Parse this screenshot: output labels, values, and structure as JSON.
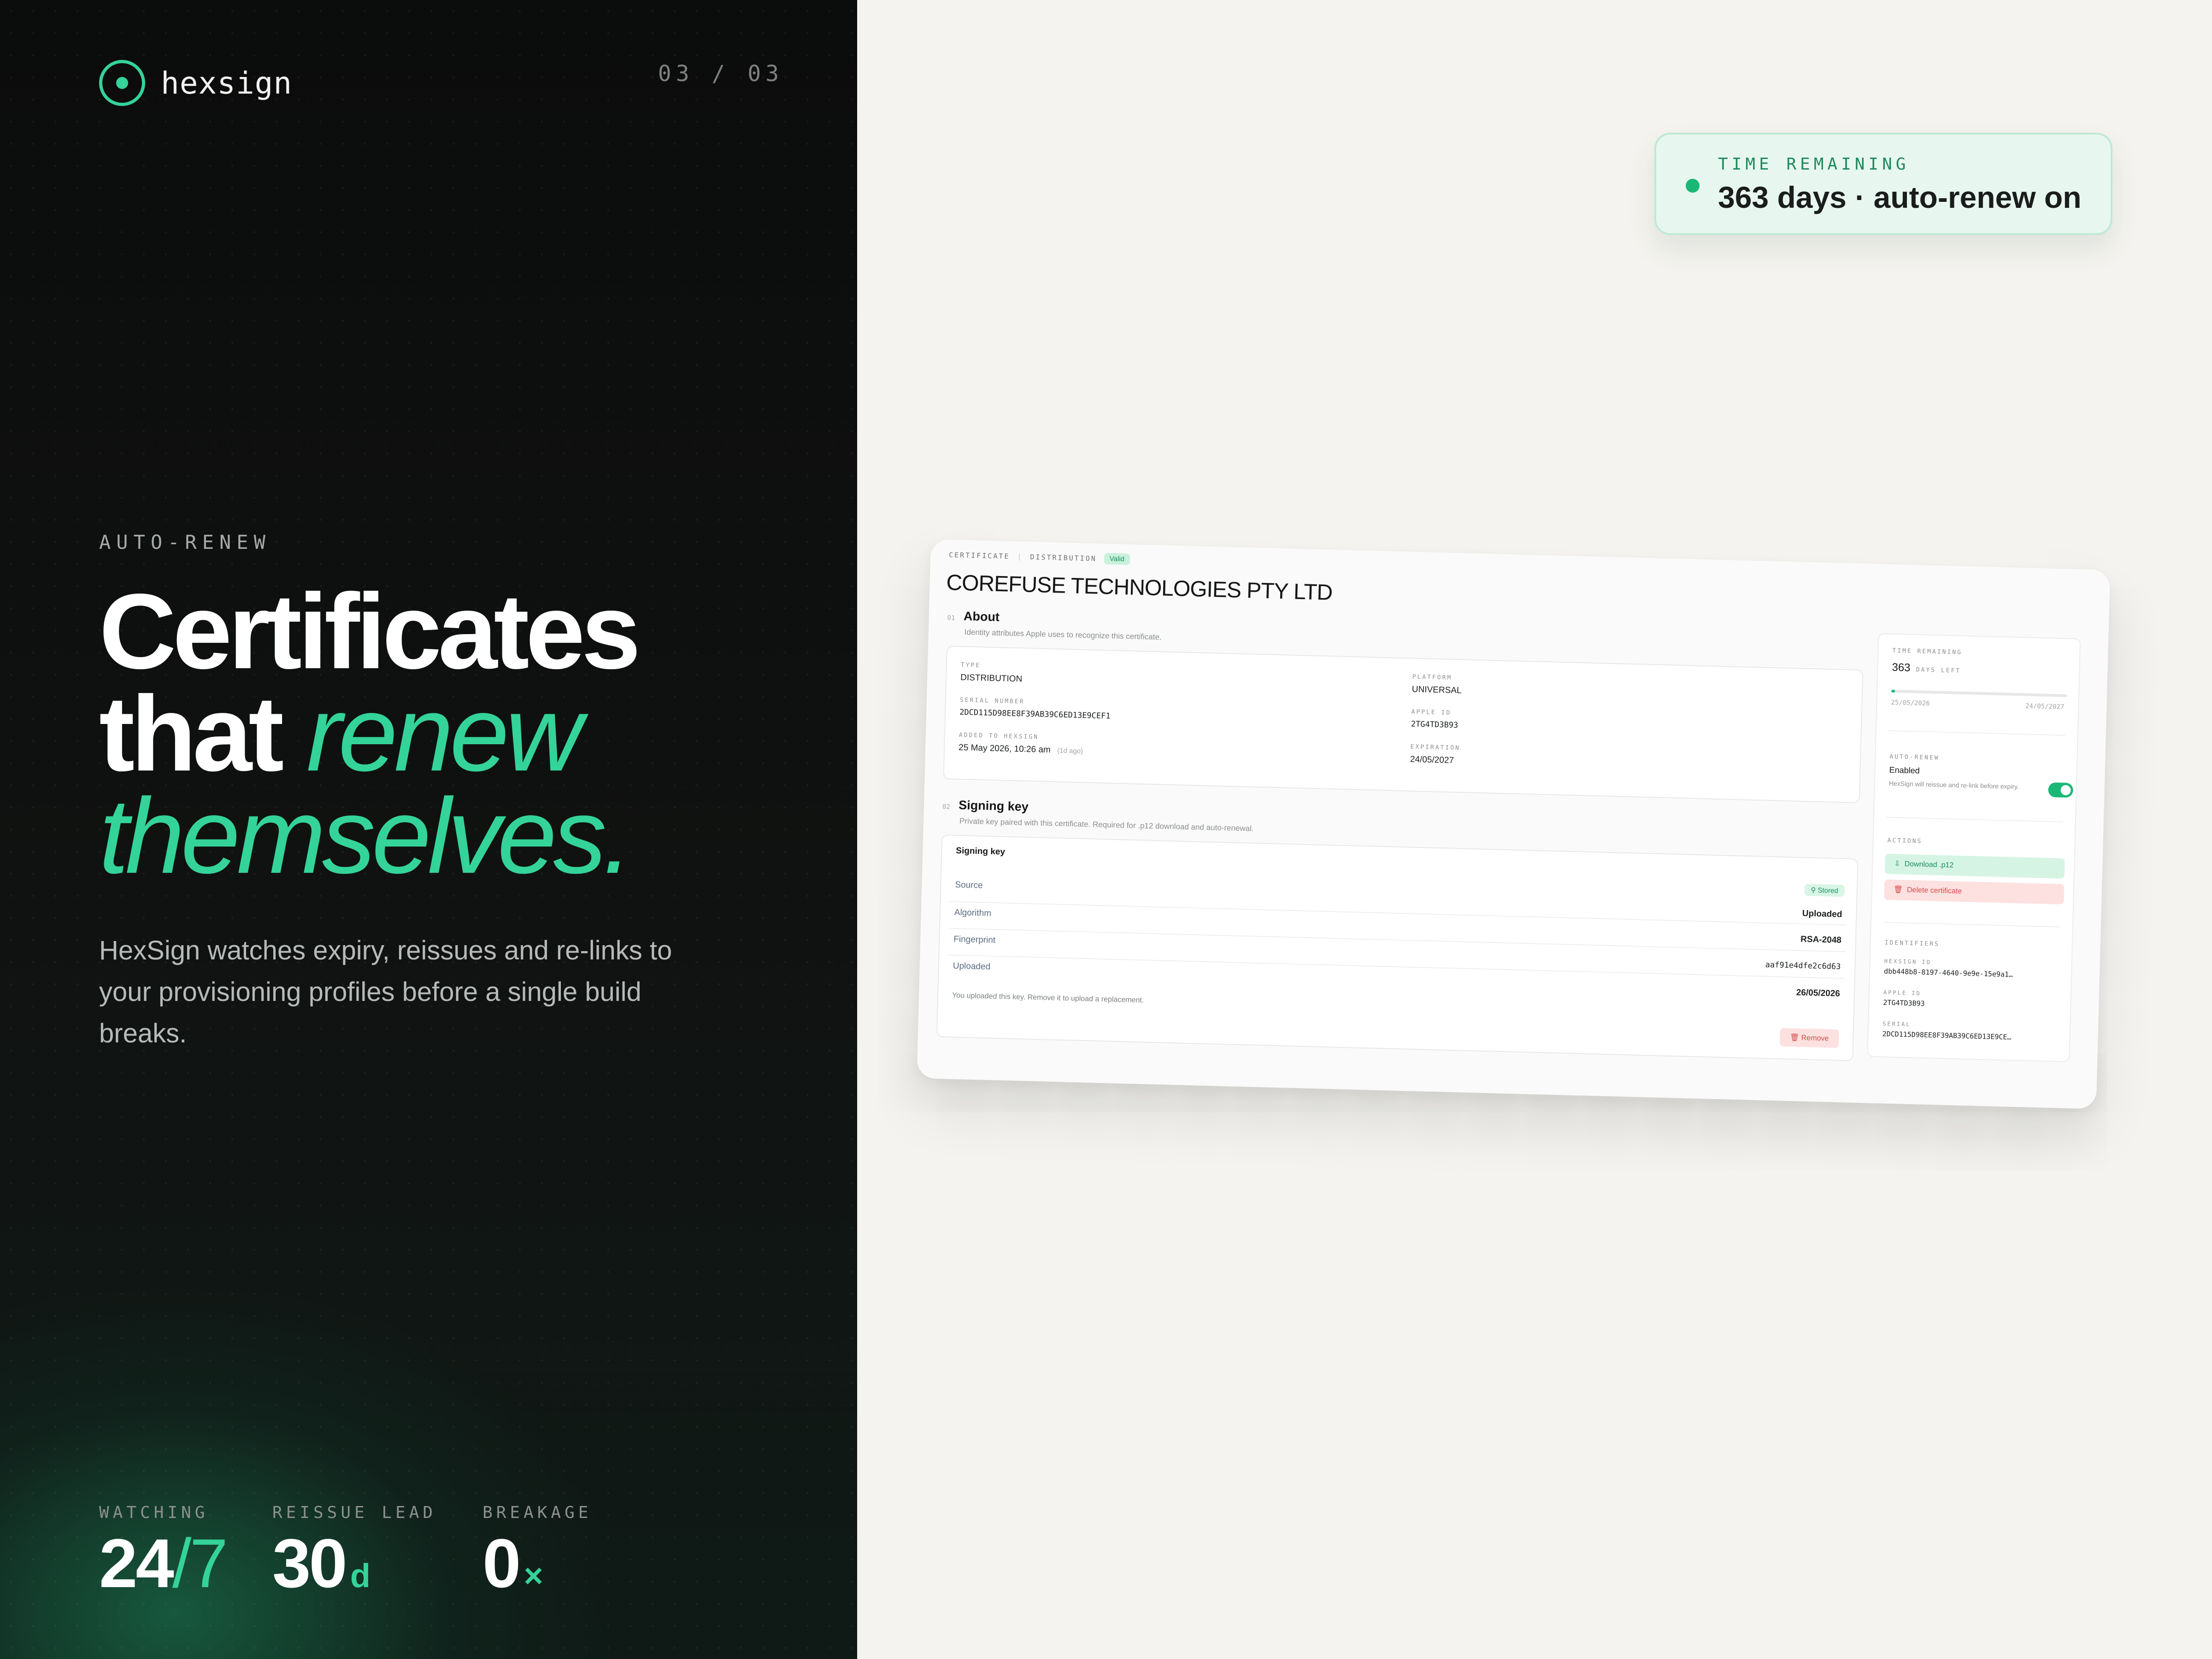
{
  "brand": {
    "name": "hexsign"
  },
  "pager": "03 / 03",
  "hero": {
    "eyebrow": "AUTO-RENEW",
    "line1": "Certificates",
    "line2_a": "that ",
    "line2_b": "renew",
    "line3": "themselves.",
    "lede": "HexSign watches expiry, reissues and re-links to your provisioning profiles before a single build breaks."
  },
  "stats": [
    {
      "label": "WATCHING",
      "value": "24",
      "suffix": "/7"
    },
    {
      "label": "REISSUE LEAD",
      "value": "30",
      "suffix": "d"
    },
    {
      "label": "BREAKAGE",
      "value": "0",
      "suffix": "×"
    }
  ],
  "pill": {
    "label": "TIME REMAINING",
    "value": "363 days · auto-renew on"
  },
  "card": {
    "crumb_a": "CERTIFICATE",
    "crumb_b": "DISTRIBUTION",
    "status": "Valid",
    "title": "COREFUSE TECHNOLOGIES PTY LTD",
    "about": {
      "num": "01",
      "title": "About",
      "desc": "Identity attributes Apple uses to recognize this certificate.",
      "type_label": "TYPE",
      "type_value": "DISTRIBUTION",
      "serial_label": "SERIAL NUMBER",
      "serial_value": "2DCD115D98EE8F39AB39C6ED13E9CEF1",
      "added_label": "ADDED TO HEXSIGN",
      "added_value": "25 May 2026, 10:26 am",
      "added_ago": "(1d ago)",
      "platform_label": "PLATFORM",
      "platform_value": "UNIVERSAL",
      "apple_label": "APPLE ID",
      "apple_value": "2TG4TD3B93",
      "exp_label": "EXPIRATION",
      "exp_value": "24/05/2027"
    },
    "signing": {
      "num": "02",
      "title": "Signing key",
      "desc": "Private key paired with this certificate. Required for .p12 download and auto-renewal.",
      "box_title": "Signing key",
      "stored": "Stored",
      "rows": [
        {
          "k": "Source",
          "v": "Uploaded"
        },
        {
          "k": "Algorithm",
          "v": "RSA-2048"
        },
        {
          "k": "Fingerprint",
          "v": "aaf91e4dfe2c6d63"
        },
        {
          "k": "Uploaded",
          "v": "26/05/2026"
        }
      ],
      "note": "You uploaded this key. Remove it to upload a replacement.",
      "remove": "Remove"
    },
    "side": {
      "time_label": "TIME REMAINING",
      "days": "363",
      "days_suffix": "DAYS LEFT",
      "progress": 0.01,
      "start": "25/05/2026",
      "end": "24/05/2027",
      "auto_label": "AUTO-RENEW",
      "auto_state": "Enabled",
      "auto_desc": "HexSign will reissue and re-link before expiry.",
      "actions_label": "ACTIONS",
      "download": "Download .p12",
      "delete": "Delete certificate",
      "ident_label": "IDENTIFIERS",
      "hex_label": "HEXSIGN ID",
      "hex_value": "dbb448b8-8197-4640-9e9e-15e9a1…",
      "apple_label": "APPLE ID",
      "apple_value": "2TG4TD3B93",
      "serial_label": "SERIAL",
      "serial_value": "2DCD115D98EE8F39AB39C6ED13E9CE…"
    }
  },
  "colors": {
    "accent": "#34d39a",
    "dark_bg": "#0b0c0c",
    "light_bg": "#f4f3ef",
    "danger": "#d44b4b"
  }
}
